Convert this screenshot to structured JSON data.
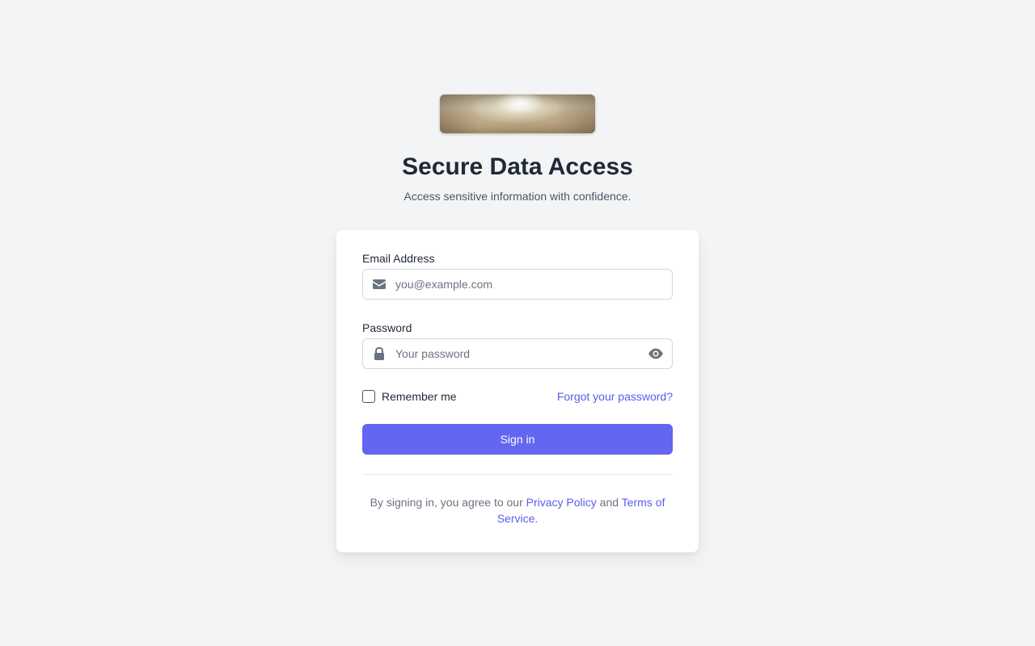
{
  "header": {
    "title": "Secure Data Access",
    "subtitle": "Access sensitive information with confidence."
  },
  "form": {
    "email": {
      "label": "Email Address",
      "placeholder": "you@example.com",
      "value": "",
      "icon": "envelope-icon"
    },
    "password": {
      "label": "Password",
      "placeholder": "Your password",
      "value": "",
      "icon": "lock-icon",
      "toggle_icon": "eye-icon"
    },
    "remember_label": "Remember me",
    "remember_checked": false,
    "forgot_link": "Forgot your password?",
    "submit_label": "Sign in"
  },
  "legal": {
    "prefix": "By signing in, you agree to our",
    "privacy_link": "Privacy Policy",
    "conjunction": "and",
    "terms_link": "Terms of Service."
  },
  "colors": {
    "accent": "#6366f1",
    "link": "#5b5cf0",
    "background": "#f3f4f6",
    "card": "#ffffff"
  }
}
